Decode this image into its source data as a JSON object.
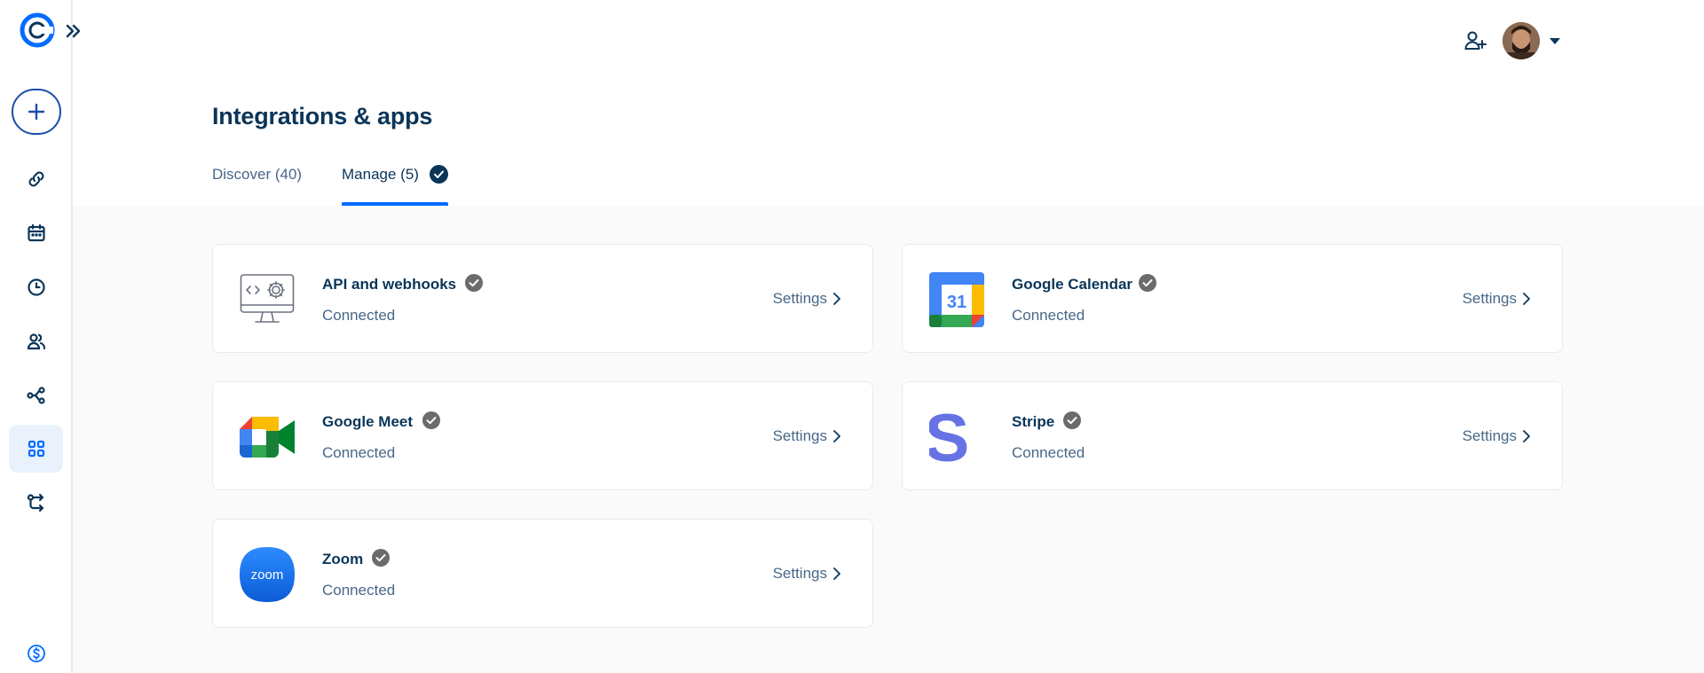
{
  "header": {
    "title": "Integrations & apps"
  },
  "tabs": [
    {
      "label": "Discover (40)"
    },
    {
      "label": "Manage (5)"
    }
  ],
  "colors": {
    "accent": "#006bff",
    "text_primary": "#0b3558",
    "text_secondary": "#476788",
    "active_nav_bg": "#e9f2fc"
  },
  "sidebar": {
    "items": [
      {
        "icon": "link-icon"
      },
      {
        "icon": "calendar-icon"
      },
      {
        "icon": "clock-icon"
      },
      {
        "icon": "people-icon"
      },
      {
        "icon": "workflow-icon"
      },
      {
        "icon": "apps-grid-icon",
        "active": true
      },
      {
        "icon": "routing-icon"
      }
    ],
    "bottom_icon": "dollar-icon"
  },
  "integrations": [
    {
      "name": "API and webhooks",
      "status": "Connected",
      "action": "Settings",
      "icon": "api-webhooks-icon"
    },
    {
      "name": "Google Calendar",
      "status": "Connected",
      "action": "Settings",
      "icon": "google-calendar-icon",
      "icon_text": "31"
    },
    {
      "name": "Google Meet",
      "status": "Connected",
      "action": "Settings",
      "icon": "google-meet-icon"
    },
    {
      "name": "Stripe",
      "status": "Connected",
      "action": "Settings",
      "icon": "stripe-icon",
      "icon_text": "S"
    },
    {
      "name": "Zoom",
      "status": "Connected",
      "action": "Settings",
      "icon": "zoom-icon",
      "icon_text": "zoom"
    }
  ]
}
